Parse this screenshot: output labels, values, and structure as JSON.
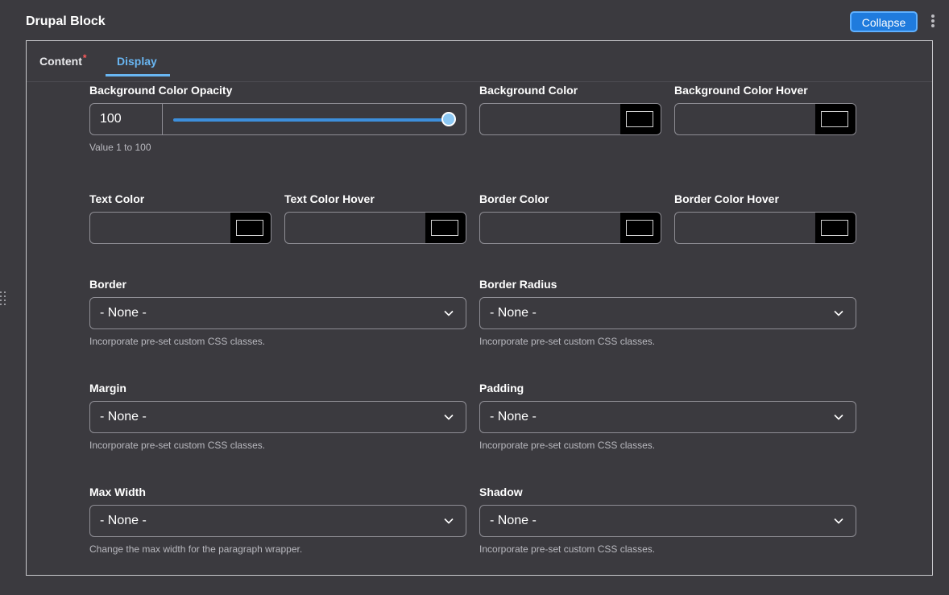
{
  "header": {
    "title": "Drupal Block",
    "collapse_label": "Collapse"
  },
  "tabs": {
    "content": "Content",
    "content_required": "*",
    "display": "Display"
  },
  "opacity": {
    "label": "Background Color Opacity",
    "value": "100",
    "slider_level": 1.0,
    "hint": "Value 1 to 100"
  },
  "colors": {
    "bg": {
      "label": "Background Color",
      "value": "#000000"
    },
    "bg_hover": {
      "label": "Background Color Hover",
      "value": "#000000"
    },
    "text": {
      "label": "Text Color",
      "value": "#000000"
    },
    "text_hover": {
      "label": "Text Color Hover",
      "value": "#000000"
    },
    "border": {
      "label": "Border Color",
      "value": "#000000"
    },
    "border_hover": {
      "label": "Border Color Hover",
      "value": "#000000"
    }
  },
  "selects": {
    "border": {
      "label": "Border",
      "value": "- None -",
      "hint": "Incorporate pre-set custom CSS classes."
    },
    "border_radius": {
      "label": "Border Radius",
      "value": "- None -",
      "hint": "Incorporate pre-set custom CSS classes."
    },
    "margin": {
      "label": "Margin",
      "value": "- None -",
      "hint": "Incorporate pre-set custom CSS classes."
    },
    "padding": {
      "label": "Padding",
      "value": "- None -",
      "hint": "Incorporate pre-set custom CSS classes."
    },
    "max_width": {
      "label": "Max Width",
      "value": "- None -",
      "hint": "Change the max width for the paragraph wrapper."
    },
    "shadow": {
      "label": "Shadow",
      "value": "- None -",
      "hint": "Incorporate pre-set custom CSS classes."
    }
  },
  "icons": {
    "kebab": "more-vertical-icon",
    "drag": "drag-handle-icon",
    "chevron": "chevron-down-icon"
  },
  "theme": {
    "accent": "#1f7bdd",
    "tab_active": "#69b6f2",
    "required": "#ff5a5a"
  }
}
